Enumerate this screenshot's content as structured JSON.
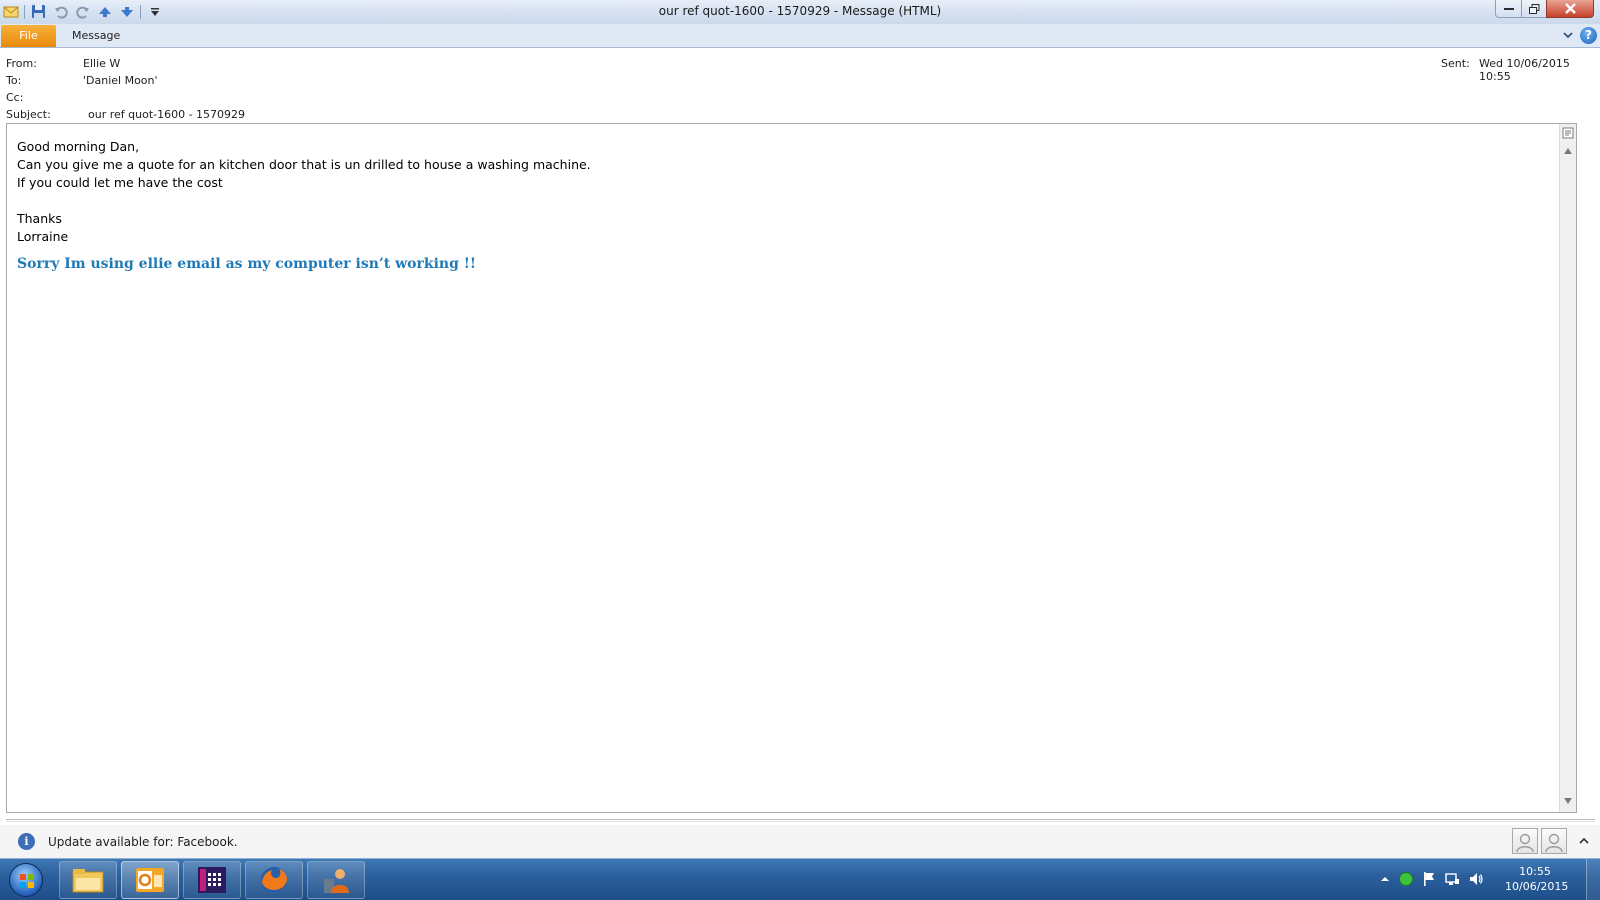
{
  "window": {
    "title": "our ref quot-1600 - 1570929  -  Message (HTML)"
  },
  "ribbon": {
    "file_tab": "File",
    "message_tab": "Message",
    "help_glyph": "?"
  },
  "header": {
    "from_label": "From:",
    "from_value": "Ellie W",
    "to_label": "To:",
    "to_value": "'Daniel Moon'",
    "cc_label": "Cc:",
    "cc_value": "",
    "subject_label": "Subject:",
    "subject_value": "our ref quot-1600 - 1570929",
    "sent_label": "Sent:",
    "sent_value": "Wed 10/06/2015 10:55"
  },
  "message": {
    "lines": [
      "Good morning Dan,",
      "Can you give me a quote for an kitchen door that is un drilled to house a washing machine.",
      "If you could let me have the cost",
      "",
      "Thanks",
      "Lorraine"
    ],
    "apology": "Sorry Im using ellie email as my computer isn’t working !!"
  },
  "infobar": {
    "text": "Update available for: Facebook.",
    "icon_glyph": "i"
  },
  "taskbar": {
    "apps": [
      "windows-explorer",
      "outlook",
      "calculator-grid-app",
      "firefox",
      "contacts-app"
    ],
    "clock_time": "10:55",
    "clock_date": "10/06/2015"
  },
  "colors": {
    "apology_text": "#1f7ab8",
    "file_tab": "#f0a020",
    "taskbar": "#2b5f9c"
  }
}
